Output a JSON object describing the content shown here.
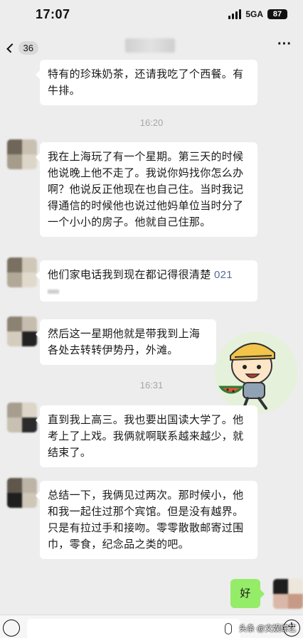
{
  "status_bar": {
    "time": "17:07",
    "network": "5GA",
    "battery": "87"
  },
  "nav": {
    "unread_count": "36",
    "more_label": "···"
  },
  "messages": [
    {
      "text": "特有的珍珠奶茶，还请我吃了个西餐。有牛排。"
    },
    {
      "text": "我在上海玩了有一个星期。第三天的时候他说晚上他不走了。我说你妈找你怎么办啊？他说反正他现在也自己住。当时我记得通信的时候他也说过他妈单位当时分了一个小小的房子。他就自己住那。"
    },
    {
      "text": "他们家电话我到现在都记得很清楚",
      "phone": "021"
    },
    {
      "text": "然后这一星期他就是带我到上海各处去转转伊势丹，外滩。"
    },
    {
      "text": "直到我上高三。我也要出国读大学了。他考上了上戏。我俩就啊联系越来越少，就结束了。"
    },
    {
      "text": "总结一下，我俩见过两次。那时候小，他和我一起住过那个宾馆。但是没有越界。只是有拉过手和接吻。零零散散邮寄过围巾，零食，纪念品之类的吧。"
    },
    {
      "text": "好"
    }
  ],
  "timestamps": [
    "16:20",
    "16:31"
  ],
  "watermark": "头条 @文娱综艺",
  "colors": {
    "background": "#ededed",
    "incoming_bubble": "#ffffff",
    "outgoing_bubble": "#95ec69",
    "timestamp": "#a6a6a6",
    "link": "#576b95"
  }
}
